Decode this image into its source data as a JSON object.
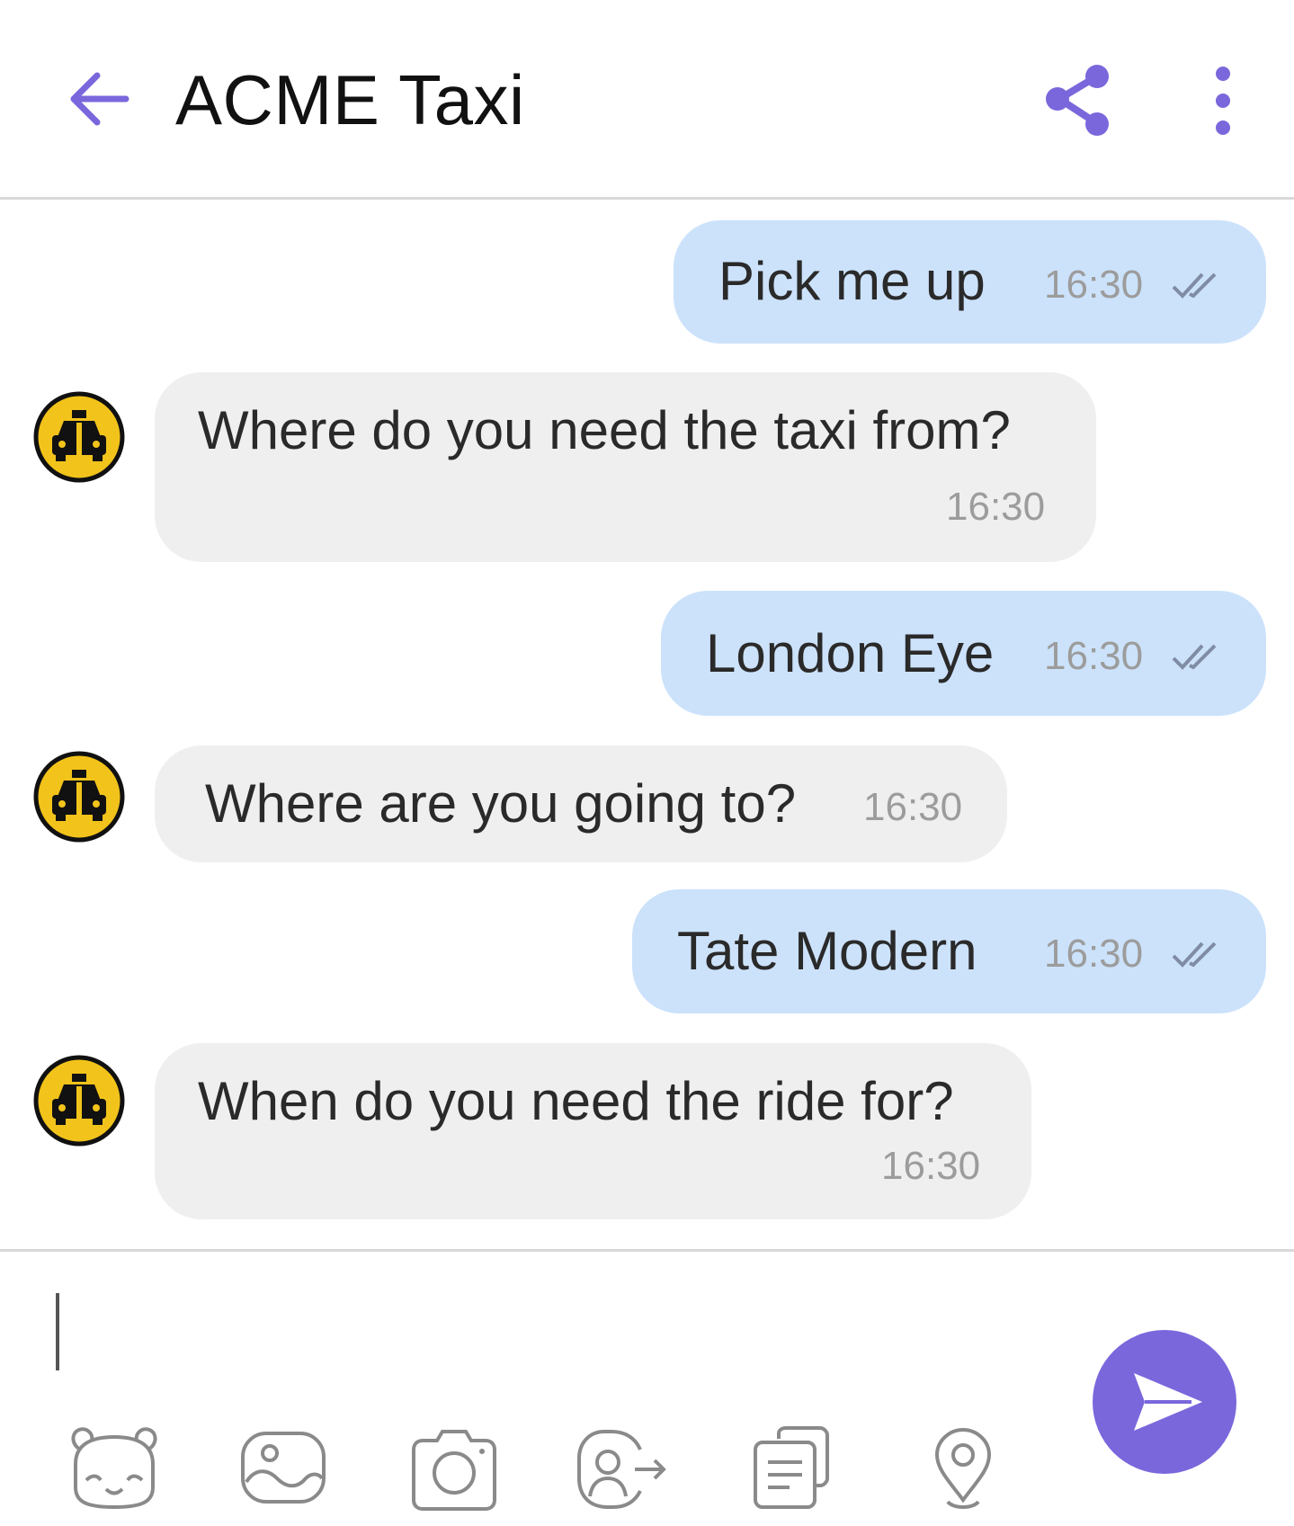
{
  "header": {
    "title": "ACME Taxi",
    "back_icon": "arrow-left-icon",
    "share_icon": "share-icon",
    "more_icon": "more-vertical-icon"
  },
  "messages": [
    {
      "direction": "outgoing",
      "text": "Pick me up",
      "time": "16:30",
      "status_icon": "double-check-icon"
    },
    {
      "direction": "incoming",
      "text": "Where do you need the taxi from?",
      "time": "16:30",
      "avatar_icon": "taxi-icon"
    },
    {
      "direction": "outgoing",
      "text": "London Eye",
      "time": "16:30",
      "status_icon": "double-check-icon"
    },
    {
      "direction": "incoming",
      "text": "Where are you going to?",
      "time": "16:30",
      "avatar_icon": "taxi-icon"
    },
    {
      "direction": "outgoing",
      "text": "Tate Modern",
      "time": "16:30",
      "status_icon": "double-check-icon"
    },
    {
      "direction": "incoming",
      "text": "When do you need the ride for?",
      "time": "16:30",
      "avatar_icon": "taxi-icon"
    }
  ],
  "composer": {
    "input_value": "",
    "send_icon": "send-icon",
    "tools": [
      "sticker-icon",
      "gallery-icon",
      "camera-icon",
      "share-contact-icon",
      "notes-icon",
      "location-pin-icon"
    ]
  },
  "colors": {
    "accent": "#7b67dc",
    "outgoing_bubble": "#cce2fb",
    "incoming_bubble": "#efefef",
    "taxi_yellow": "#f2c31a"
  }
}
